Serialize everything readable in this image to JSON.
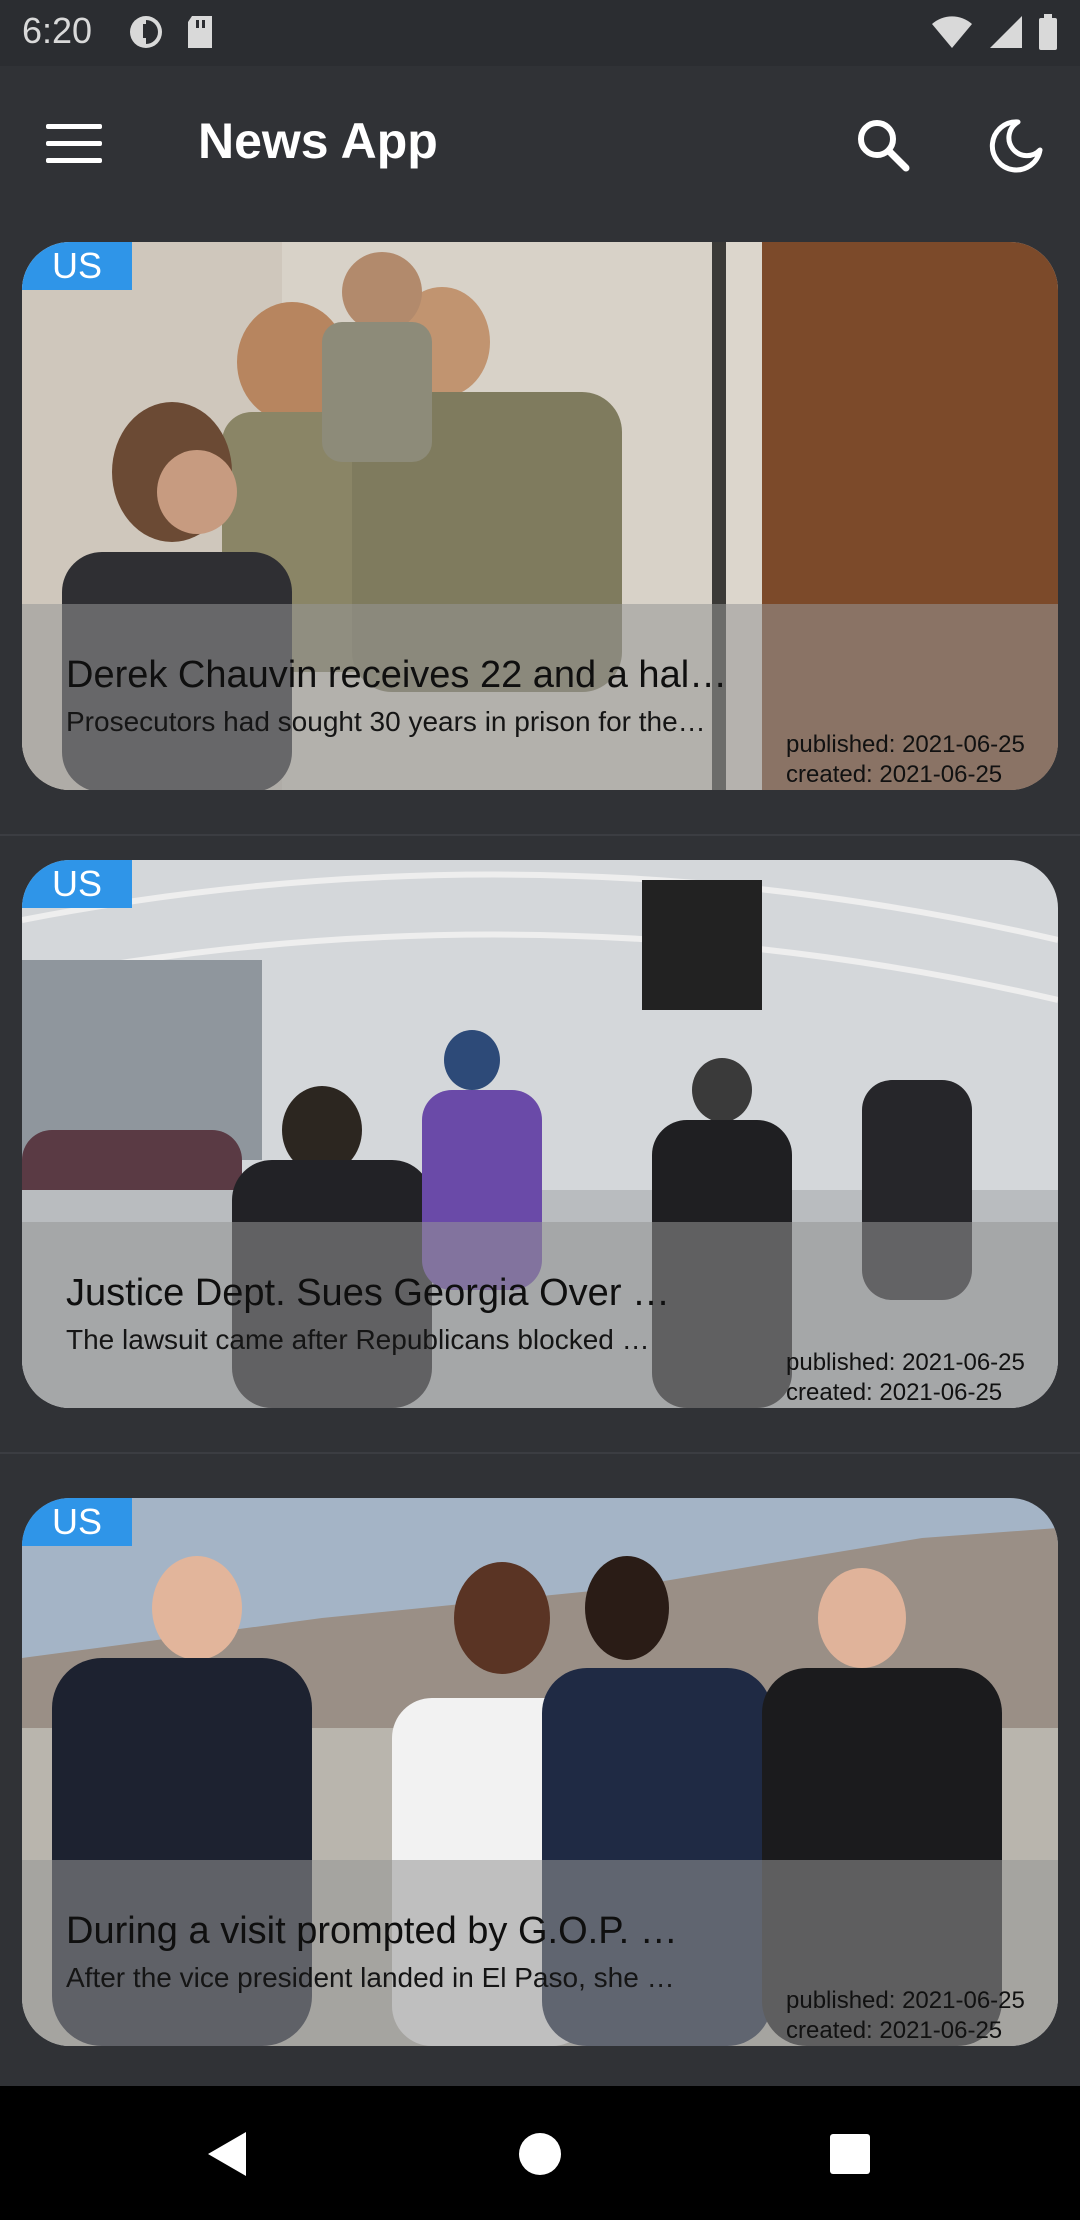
{
  "status_bar": {
    "time": "6:20",
    "left_icons": [
      "data-saver-icon",
      "sd-card-icon"
    ],
    "right_icons": [
      "wifi-icon",
      "signal-icon",
      "battery-icon"
    ]
  },
  "app_bar": {
    "title": "News App",
    "menu_icon": "menu-icon",
    "search_icon": "search-icon",
    "theme_icon": "dark-mode-moon-icon"
  },
  "articles": [
    {
      "badge": "US",
      "title": "Derek Chauvin receives 22 and a hal…",
      "description": "Prosecutors had sought 30 years in prison for the…",
      "published": "published: 2021-06-25",
      "created": "created: 2021-06-25"
    },
    {
      "badge": "US",
      "title": "Justice Dept. Sues Georgia Over …",
      "description": "The lawsuit came after Republicans blocked …",
      "published": "published: 2021-06-25",
      "created": "created: 2021-06-25"
    },
    {
      "badge": "US",
      "title": "During a visit prompted by G.O.P. …",
      "description": "After the vice president landed in El Paso, she …",
      "published": "published: 2021-06-25",
      "created": "created: 2021-06-25"
    }
  ],
  "nav_bar": {
    "back_icon": "back-triangle-icon",
    "home_icon": "home-circle-icon",
    "recents_icon": "recents-square-icon"
  },
  "colors": {
    "background": "#303236",
    "badge": "#2f95e8",
    "nav_bar": "#000000"
  }
}
